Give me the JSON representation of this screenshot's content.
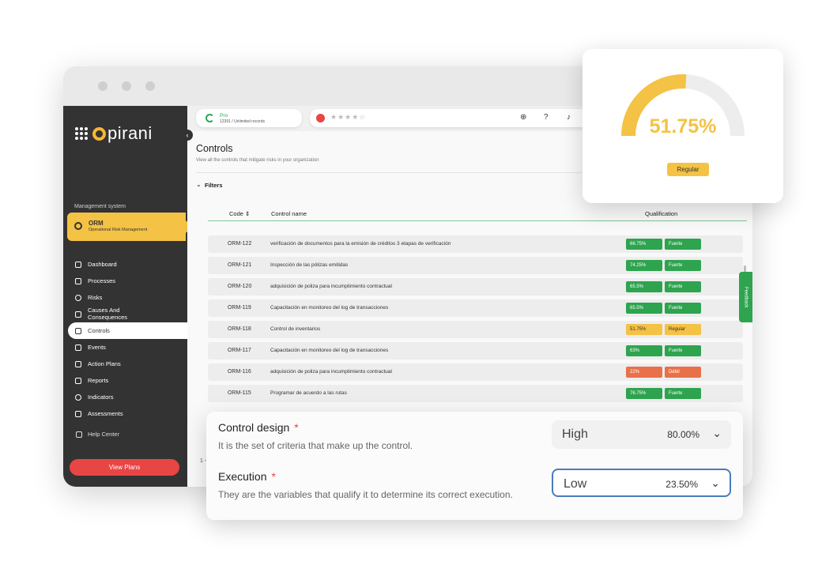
{
  "brand": {
    "name": "pirani"
  },
  "sidebar": {
    "section_label": "Management system",
    "module": {
      "title": "ORM",
      "subtitle": "Operational Risk Management"
    },
    "items": [
      {
        "label": "Dashboard",
        "icon": "monitor-icon"
      },
      {
        "label": "Processes",
        "icon": "processes-icon"
      },
      {
        "label": "Risks",
        "icon": "alert-circle-icon"
      },
      {
        "label": "Causes And Consequences",
        "icon": "causes-icon"
      },
      {
        "label": "Controls",
        "icon": "sliders-icon",
        "active": true
      },
      {
        "label": "Events",
        "icon": "warning-icon"
      },
      {
        "label": "Action Plans",
        "icon": "clipboard-check-icon"
      },
      {
        "label": "Reports",
        "icon": "report-icon"
      },
      {
        "label": "Indicators",
        "icon": "crosshair-icon"
      },
      {
        "label": "Assessments",
        "icon": "assessment-icon"
      }
    ],
    "help_label": "Help Center",
    "view_plans_label": "View Plans"
  },
  "topbar": {
    "plan_title": "Pro",
    "plan_subtitle": "12391 / Unlimited records",
    "rating_stars": "★★★★☆"
  },
  "page": {
    "title": "Controls",
    "subtitle": "View all the controls that mitigate risks in your organization",
    "filters_label": "Filters"
  },
  "table": {
    "headers": {
      "code": "Code",
      "name": "Control name",
      "qualification": "Qualification"
    },
    "rows": [
      {
        "code": "ORM-122",
        "name": "verificación de documentos para la emisión de créditos 3 etapas de verificación",
        "pct": "66.75%",
        "qual": "Fuerte",
        "color": "#2ea44f"
      },
      {
        "code": "ORM-121",
        "name": "Inspección de las pólizas emitidas",
        "pct": "74.25%",
        "qual": "Fuerte",
        "color": "#2ea44f"
      },
      {
        "code": "ORM-120",
        "name": "adquisición de poliza para incumplimiento contractual",
        "pct": "65.5%",
        "qual": "Fuerte",
        "color": "#2ea44f"
      },
      {
        "code": "ORM-119",
        "name": "Capacitación en monitoreo del log de transacciones",
        "pct": "65.5%",
        "qual": "Fuerte",
        "color": "#2ea44f"
      },
      {
        "code": "ORM-118",
        "name": "Control de inventarios",
        "pct": "51.75%",
        "qual": "Regular",
        "color": "#f4c244"
      },
      {
        "code": "ORM-117",
        "name": "Capacitación en monitoreo del log de transacciones",
        "pct": "63%",
        "qual": "Fuerte",
        "color": "#2ea44f"
      },
      {
        "code": "ORM-116",
        "name": "adquisición de poliza para incumplimiento contractual",
        "pct": "22%",
        "qual": "Débil",
        "color": "#e8714a"
      },
      {
        "code": "ORM-115",
        "name": "Programar de acuerdo a las rutas",
        "pct": "76.75%",
        "qual": "Fuerte",
        "color": "#2ea44f"
      }
    ],
    "pager_text": "1 -"
  },
  "feedback_label": "Feedback",
  "gauge": {
    "value": "51.75%",
    "fraction": 0.5175,
    "label": "Regular",
    "color": "#f4c244"
  },
  "criteria": {
    "design": {
      "title": "Control design",
      "required": "*",
      "description": "It is the set of criteria that make up the control.",
      "level": "High",
      "pct": "80.00%"
    },
    "execution": {
      "title": "Execution",
      "required": "*",
      "description": "They are the variables that qualify it to determine its correct execution.",
      "level": "Low",
      "pct": "23.50%"
    }
  }
}
